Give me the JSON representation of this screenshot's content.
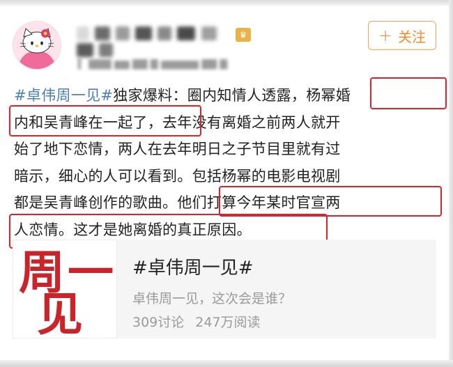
{
  "header": {
    "username": "",
    "meta": "",
    "follow_label": "关注",
    "follow_icon": "plus-icon"
  },
  "post": {
    "lines": [
      "#卓伟周一见#独家爆料：圈内知情人透露，杨幂婚",
      "内和吴青峰在一起了，去年没有离婚之前两人就开",
      "始了地下恋情，两人在去年明日之子节目里就有过",
      "暗示，细心的人可以看到。包括杨幂的电影电视剧",
      "都是吴青峰创作的歌曲。他们打算今年某时官宣两",
      "人恋情。这才是她离婚的真正原因。"
    ],
    "hashtag": "#卓伟周一见#",
    "line1_rest": "独家爆料：圈内知情人透露，",
    "line1_hl": "杨幂婚",
    "line2_hl": "内和吴青峰在一起了，",
    "line2_rest": "去年没有离婚之前两人就开",
    "line3": "始了地下恋情，两人在去年明日之子节目里就有过",
    "line4": "暗示，细心的人可以看到。包括杨幂的电影电视剧",
    "line5_rest": "都是吴青峰创作的歌曲。",
    "line5_hl": "他们打算今年某时官宣两",
    "line6_hl": "人恋情。这才是她离婚的真正原因。",
    "highlight_color": "#e0202a",
    "hashtag_color": "#4b7fb5"
  },
  "topic_card": {
    "thumb_text": [
      "周",
      "一",
      "见"
    ],
    "title": "#卓伟周一见#",
    "description": "卓伟周一见，这次会是谁？",
    "discussions": "309讨论",
    "reads": "247万阅读"
  }
}
